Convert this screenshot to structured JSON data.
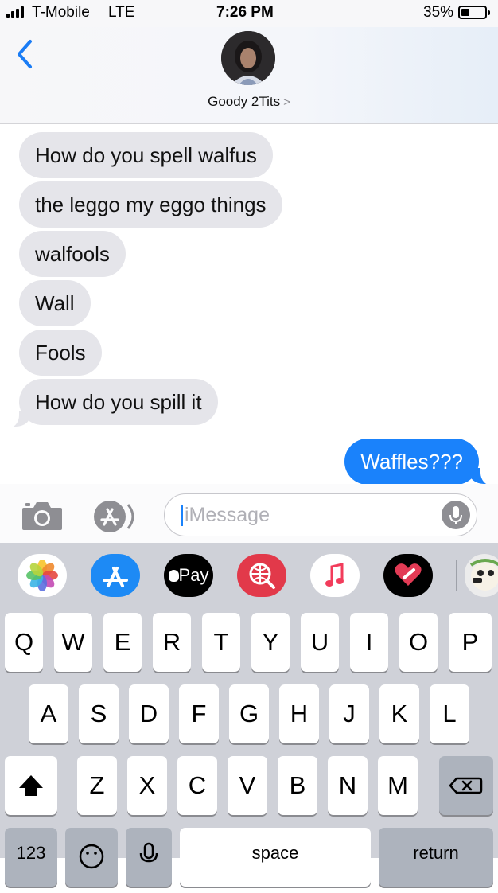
{
  "status_bar": {
    "carrier": "T-Mobile",
    "network": "LTE",
    "time": "7:26 PM",
    "battery_percent": "35%"
  },
  "header": {
    "contact_name": "Goody 2Tits",
    "chevron": ">"
  },
  "messages": [
    {
      "text": "How do you spell walfus",
      "direction": "incoming"
    },
    {
      "text": "the leggo my eggo things",
      "direction": "incoming"
    },
    {
      "text": "walfools",
      "direction": "incoming"
    },
    {
      "text": "Wall",
      "direction": "incoming"
    },
    {
      "text": "Fools",
      "direction": "incoming"
    },
    {
      "text": "How do you spill it",
      "direction": "incoming"
    },
    {
      "text": "Waffles???",
      "direction": "outgoing"
    }
  ],
  "input": {
    "placeholder": "iMessage"
  },
  "apps": {
    "pay_label": "Pay",
    "icons": [
      "photos-icon",
      "app-store-icon",
      "apple-pay-icon",
      "web-images-icon",
      "music-icon",
      "digital-touch-icon",
      "memoji-icon"
    ]
  },
  "keyboard": {
    "row1": [
      "Q",
      "W",
      "E",
      "R",
      "T",
      "Y",
      "U",
      "I",
      "O",
      "P"
    ],
    "row2": [
      "A",
      "S",
      "D",
      "F",
      "G",
      "H",
      "J",
      "K",
      "L"
    ],
    "row3": [
      "Z",
      "X",
      "C",
      "V",
      "B",
      "N",
      "M"
    ],
    "numbers_label": "123",
    "space_label": "space",
    "return_label": "return"
  },
  "colors": {
    "outgoing_bubble": "#1a82fb",
    "incoming_bubble": "#e5e5ea",
    "keyboard_bg": "#cfd1d8"
  }
}
